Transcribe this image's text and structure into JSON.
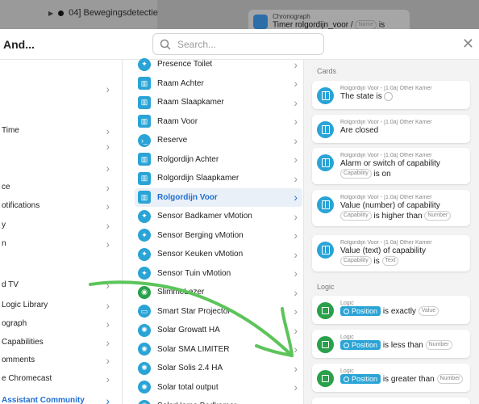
{
  "background": {
    "node_label": "04] Bewegingsdetectie",
    "card_subtitle": "Chronograph",
    "card_title": "Timer rolgordijn_voor / ",
    "card_title_tail": "is"
  },
  "header": {
    "title": "And...",
    "search_placeholder": "Search..."
  },
  "col1": {
    "items": [
      {
        "label": "",
        "active": false
      },
      {
        "label": "",
        "active": false
      },
      {
        "label": "Time",
        "active": false
      },
      {
        "label": "",
        "active": false
      },
      {
        "label": "",
        "active": false
      },
      {
        "label": "ce",
        "active": false
      },
      {
        "label": "otifications",
        "active": false
      },
      {
        "label": "y",
        "active": false
      },
      {
        "label": "n",
        "active": false
      },
      {
        "label": "",
        "active": false
      },
      {
        "label": "d TV",
        "active": false
      },
      {
        "label": "Logic Library",
        "active": false
      },
      {
        "label": "ograph",
        "active": false
      },
      {
        "label": " Capabilities",
        "active": false
      },
      {
        "label": "omments",
        "active": false
      },
      {
        "label": "e Chromecast",
        "active": false
      },
      {
        "label": "Assistant Community",
        "active": true
      }
    ]
  },
  "col2": {
    "items": [
      {
        "label": "Presence Toilet",
        "icon": "walk-icon",
        "active": false
      },
      {
        "label": "Raam Achter",
        "icon": "window-icon",
        "active": false
      },
      {
        "label": "Raam Slaapkamer",
        "icon": "window-icon",
        "active": false
      },
      {
        "label": "Raam Voor",
        "icon": "window-icon",
        "active": false
      },
      {
        "label": "Reserve",
        "icon": "terminal-icon",
        "active": false
      },
      {
        "label": "Rolgordijn Achter",
        "icon": "blind-icon",
        "active": false
      },
      {
        "label": "Rolgordijn Slaapkamer",
        "icon": "blind-icon",
        "active": false
      },
      {
        "label": "Rolgordijn Voor",
        "icon": "blind-icon",
        "active": true
      },
      {
        "label": "Sensor Badkamer vMotion",
        "icon": "walk-icon",
        "active": false
      },
      {
        "label": "Sensor Berging vMotion",
        "icon": "walk-icon",
        "active": false
      },
      {
        "label": "Sensor Keuken vMotion",
        "icon": "walk-icon",
        "active": false
      },
      {
        "label": "Sensor Tuin vMotion",
        "icon": "walk-icon",
        "active": false
      },
      {
        "label": "SlimmeLezer",
        "icon": "meter-icon",
        "active": false
      },
      {
        "label": "Smart Star Projector",
        "icon": "projector-icon",
        "active": false
      },
      {
        "label": "Solar Growatt HA",
        "icon": "sun-icon",
        "active": false
      },
      {
        "label": "Solar SMA LIMITER",
        "icon": "sun-icon",
        "active": false
      },
      {
        "label": "Solar Solis 2.4 HA",
        "icon": "sun-icon",
        "active": false
      },
      {
        "label": "Solar total output",
        "icon": "sun-icon",
        "active": false
      },
      {
        "label": "SolarHome Badkamer",
        "icon": "sun-icon",
        "active": false
      }
    ]
  },
  "col3": {
    "cards_title": "Cards",
    "logic_title": "Logic",
    "cards": [
      {
        "sub": "Rolgordijn Voor - [1.0a] Other Kamer",
        "text": "The state is"
      },
      {
        "sub": "Rolgordijn Voor - [1.0a] Other Kamer",
        "text": "Are closed"
      },
      {
        "sub": "Rolgordijn Voor - [1.0a] Other Kamer",
        "text": "Alarm or switch of capability",
        "tag": "Capability",
        "tail": "is on"
      },
      {
        "sub": "Rolgordijn Voor - [1.0a] Other Kamer",
        "text": "Value (number) of capability",
        "tag": "Capability",
        "tail": "is higher than",
        "tag2": "Number"
      },
      {
        "sub": "Rolgordijn Voor - [1.0a] Other Kamer",
        "text": "Value (text) of capability",
        "tag": "Capability",
        "tail": "is",
        "tag2": "Text"
      }
    ],
    "logic": [
      {
        "sub": "Logic",
        "pos": "Position",
        "text": "is exactly",
        "tag": "Value"
      },
      {
        "sub": "Logic",
        "pos": "Position",
        "text": "is less than",
        "tag": "Number"
      },
      {
        "sub": "Logic",
        "pos": "Position",
        "text": "is greater than",
        "tag": "Number"
      }
    ]
  },
  "colors": {
    "accent": "#1f6fd1",
    "device_icon": "#2aa4d6",
    "logic_icon": "#29a04a",
    "annotation_arrow": "#5cc45a"
  }
}
